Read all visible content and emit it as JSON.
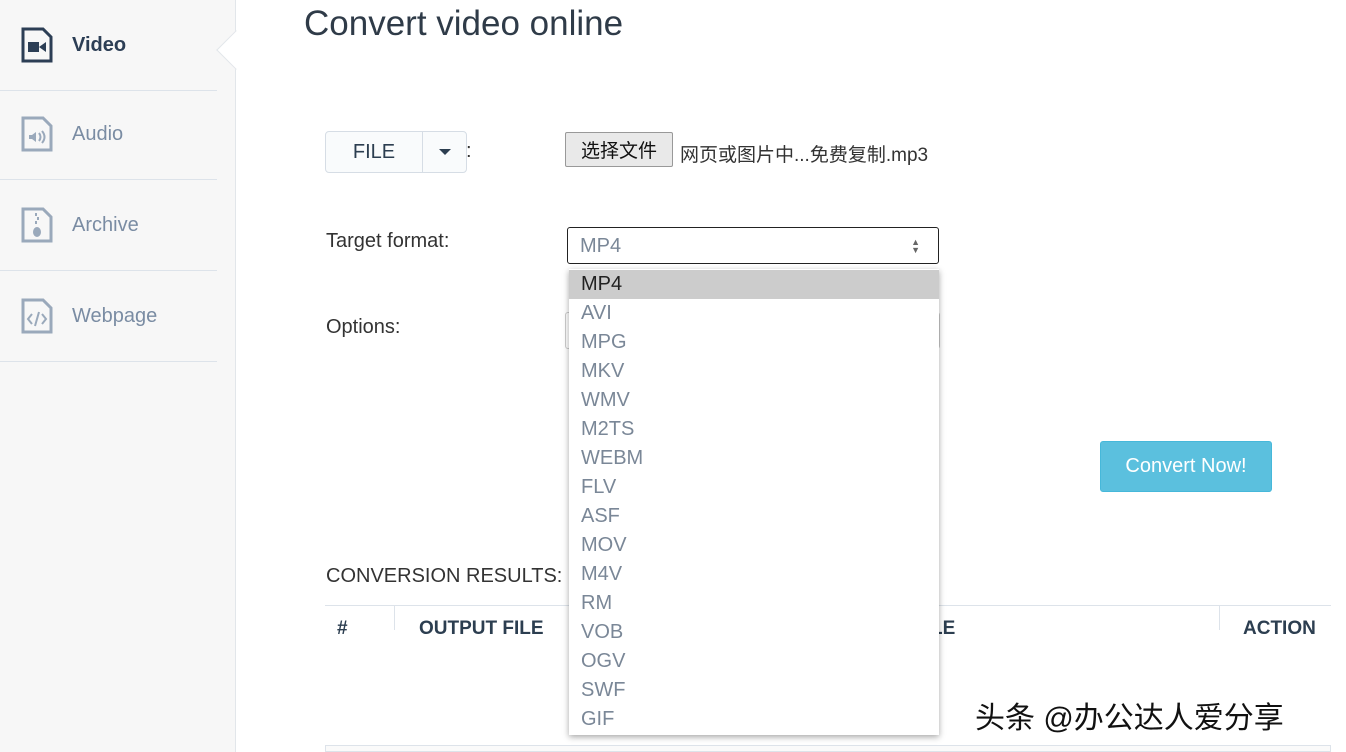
{
  "sidebar": {
    "items": [
      {
        "label": "Video",
        "icon": "video-file-icon",
        "active": true
      },
      {
        "label": "Audio",
        "icon": "audio-file-icon"
      },
      {
        "label": "Archive",
        "icon": "archive-file-icon"
      },
      {
        "label": "Webpage",
        "icon": "code-file-icon"
      }
    ]
  },
  "main": {
    "title": "Convert video online",
    "source_button": "FILE",
    "source_colon": ":",
    "choose_file": "选择文件",
    "file_name": "网页或图片中...免费复制.mp3",
    "target_label": "Target format:",
    "target_value": "MP4",
    "options_label": "Options:",
    "convert_button": "Convert Now!",
    "results_label": "CONVERSION RESULTS:",
    "columns": [
      "#",
      "OUTPUT FILE",
      "LE",
      "ACTION"
    ]
  },
  "dropdown": {
    "options": [
      "MP4",
      "AVI",
      "MPG",
      "MKV",
      "WMV",
      "M2TS",
      "WEBM",
      "FLV",
      "ASF",
      "MOV",
      "M4V",
      "RM",
      "VOB",
      "OGV",
      "SWF",
      "GIF"
    ],
    "selected": "MP4"
  },
  "watermark": "头条 @办公达人爱分享",
  "colors": {
    "accent": "#5bc0de",
    "sidebar_active": "#2c3e55",
    "sidebar_inactive": "#7a8ca3"
  }
}
